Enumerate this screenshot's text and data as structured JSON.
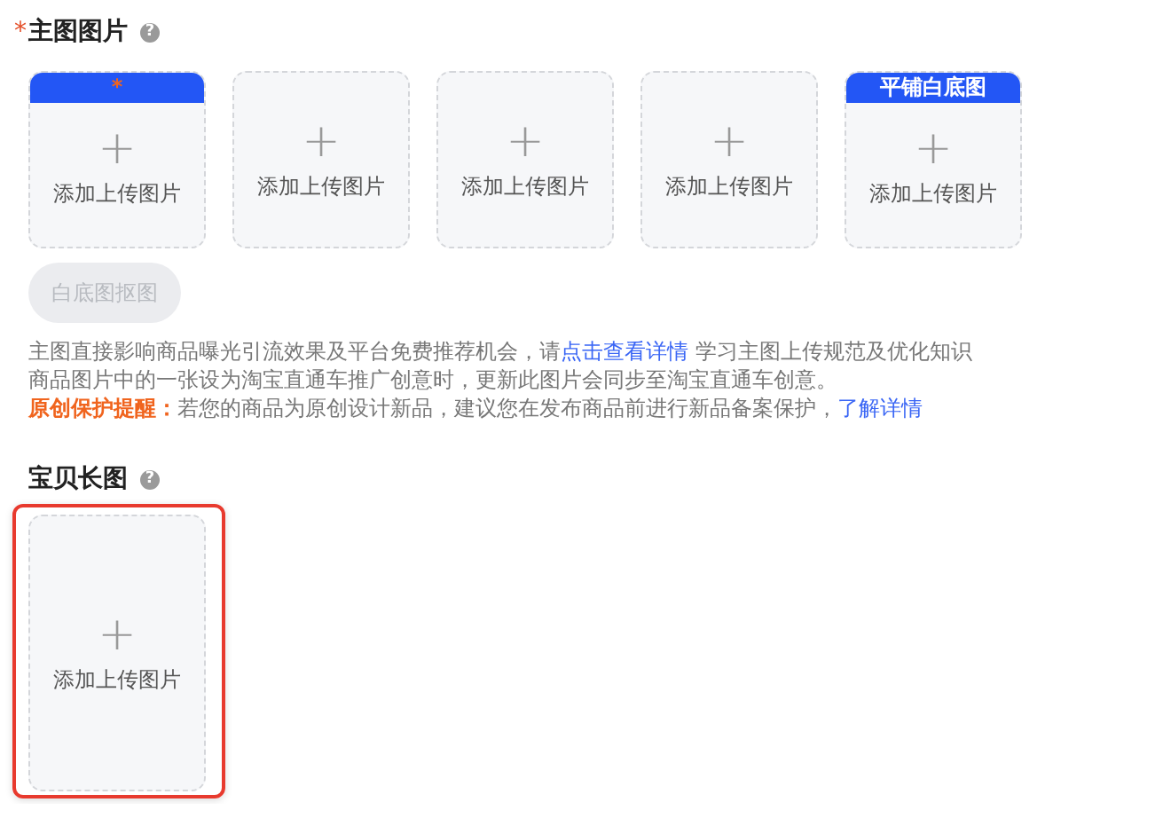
{
  "main_images": {
    "required_mark": "*",
    "title": "主图图片",
    "help": "?",
    "tiles": [
      {
        "badge": "*",
        "kind": "mark",
        "plus": "+",
        "label": "添加上传图片"
      },
      {
        "plus": "+",
        "label": "添加上传图片"
      },
      {
        "plus": "+",
        "label": "添加上传图片"
      },
      {
        "plus": "+",
        "label": "添加上传图片"
      },
      {
        "badge": "平铺白底图",
        "kind": "text",
        "plus": "+",
        "label": "添加上传图片"
      }
    ],
    "cutout_button": {
      "label": "白底图抠图",
      "disabled": true
    },
    "hint_line_1": {
      "before": "主图直接影响商品曝光引流效果及平台免费推荐机会，请",
      "link": "点击查看详情",
      "after": " 学习主图上传规范及优化知识"
    },
    "hint_line_2": "商品图片中的一张设为淘宝直通车推广创意时，更新此图片会同步至淘宝直通车创意。",
    "notice": {
      "label": "原创保护提醒：",
      "text": "若您的商品为原创设计新品，建议您在发布商品前进行新品备案保护，",
      "link": "了解详情"
    }
  },
  "long_image": {
    "title": "宝贝长图",
    "help": "?",
    "tile": {
      "plus": "+",
      "label": "添加上传图片",
      "highlighted": true
    }
  }
}
